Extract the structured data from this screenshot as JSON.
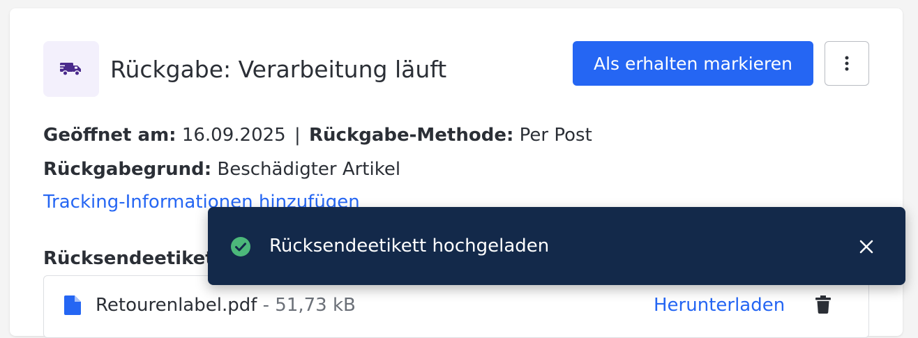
{
  "header": {
    "title": "Rückgabe: Verarbeitung läuft",
    "icon": "truck-icon",
    "icon_color": "#4a2a8c",
    "icon_bg": "#f3f0fc"
  },
  "actions": {
    "primary_label": "Als erhalten markieren",
    "primary_color": "#2566f3",
    "more_icon": "more-vertical-icon"
  },
  "details": {
    "opened_label": "Geöffnet am:",
    "opened_value": "16.09.2025",
    "separator": "|",
    "method_label": "Rückgabe-Methode:",
    "method_value": "Per Post",
    "reason_label": "Rückgabegrund:",
    "reason_value": "Beschädigter Artikel"
  },
  "tracking_link": "Tracking-Informationen hinzufügen",
  "label_section": {
    "heading": "Rücksendeetikett",
    "file": {
      "icon": "file-icon",
      "name": "Retourenlabel.pdf",
      "size": "- 51,73 kB",
      "download_label": "Herunterladen",
      "delete_icon": "trash-icon"
    }
  },
  "toast": {
    "icon": "check-circle-icon",
    "message": "Rücksendeetikett hochgeladen",
    "close_icon": "close-icon",
    "background": "#13294a",
    "success_color": "#4cb87a"
  }
}
